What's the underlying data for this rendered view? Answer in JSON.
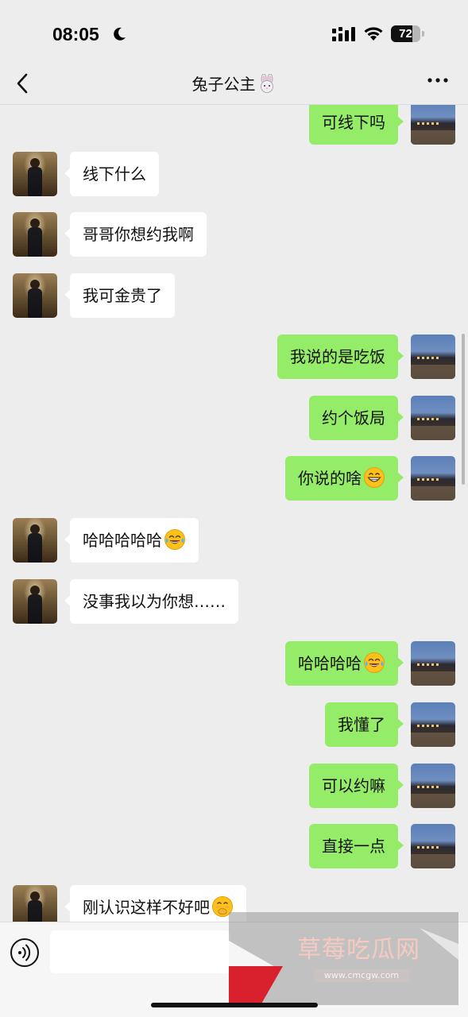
{
  "status_bar": {
    "time": "08:05",
    "battery_level": "72",
    "battery_fraction": 0.72,
    "icons": [
      "moon-icon",
      "signal-icon",
      "wifi-icon",
      "battery-icon"
    ]
  },
  "nav": {
    "title": "兔子公主",
    "title_emoji": "rabbit-face-icon",
    "back_icon": "chevron-left-icon",
    "more_icon": "more-dots-icon"
  },
  "messages": [
    {
      "side": "right",
      "text": "可线下吗",
      "emoji": null
    },
    {
      "side": "left",
      "text": "线下什么",
      "emoji": null
    },
    {
      "side": "left",
      "text": "哥哥你想约我啊",
      "emoji": null
    },
    {
      "side": "left",
      "text": "我可金贵了",
      "emoji": null
    },
    {
      "side": "right",
      "text": "我说的是吃饭",
      "emoji": null
    },
    {
      "side": "right",
      "text": "约个饭局",
      "emoji": null
    },
    {
      "side": "right",
      "text": "你说的啥",
      "emoji": "grinning-face-icon"
    },
    {
      "side": "left",
      "text": "哈哈哈哈哈",
      "emoji": "tears-of-joy-icon"
    },
    {
      "side": "left",
      "text": "没事我以为你想……",
      "emoji": null
    },
    {
      "side": "right",
      "text": "哈哈哈哈",
      "emoji": "tears-of-joy-icon"
    },
    {
      "side": "right",
      "text": "我懂了",
      "emoji": null
    },
    {
      "side": "right",
      "text": "可以约嘛",
      "emoji": null
    },
    {
      "side": "right",
      "text": "直接一点",
      "emoji": null
    },
    {
      "side": "left",
      "text": "刚认识这样不好吧",
      "emoji": "hand-over-mouth-icon"
    }
  ],
  "input_bar": {
    "placeholder": "",
    "value": "",
    "voice_icon": "voice-icon"
  },
  "watermark": {
    "title": "草莓吃瓜网",
    "url": "www.cmcgw.com"
  },
  "colors": {
    "background": "#ededed",
    "outgoing_bubble": "#95ec69",
    "incoming_bubble": "#ffffff"
  }
}
